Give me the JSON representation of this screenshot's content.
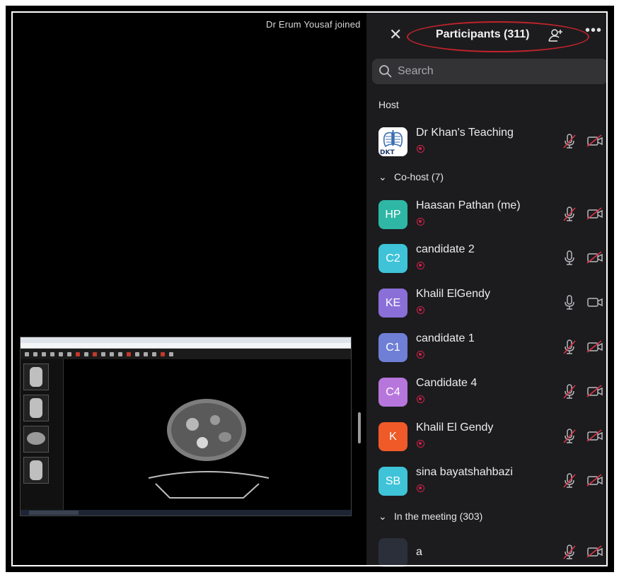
{
  "notification": "Dr Erum Yousaf joined",
  "panel": {
    "title": "Participants (311)",
    "search_placeholder": "Search"
  },
  "sections": {
    "host": "Host",
    "cohost": "Co-host (7)",
    "meeting": "In the meeting (303)"
  },
  "participants": [
    {
      "initials": "",
      "name": "Dr Khan's Teaching",
      "color": "#ffffff",
      "logo_text": "DKT",
      "mic_muted": true,
      "cam_off": true
    },
    {
      "initials": "HP",
      "name": "Haasan Pathan (me)",
      "color": "#2fb7a6",
      "mic_muted": true,
      "cam_off": true
    },
    {
      "initials": "C2",
      "name": "candidate 2",
      "color": "#3ec3d8",
      "mic_muted": false,
      "cam_off": true
    },
    {
      "initials": "KE",
      "name": "Khalil ElGendy",
      "color": "#8a6fd8",
      "mic_muted": false,
      "cam_off": false
    },
    {
      "initials": "C1",
      "name": "candidate 1",
      "color": "#6f7fd6",
      "mic_muted": true,
      "cam_off": true
    },
    {
      "initials": "C4",
      "name": "Candidate 4",
      "color": "#b776dc",
      "mic_muted": true,
      "cam_off": true
    },
    {
      "initials": "K",
      "name": "Khalil El Gendy",
      "color": "#ef5a28",
      "mic_muted": true,
      "cam_off": true
    },
    {
      "initials": "SB",
      "name": "sina bayatshahbazi",
      "color": "#3ec3d8",
      "mic_muted": true,
      "cam_off": true
    },
    {
      "initials": "",
      "name": "a",
      "color": "#2a2f3a",
      "mic_muted": true,
      "cam_off": true
    }
  ],
  "colors": {
    "panel_bg": "#1c1c1e",
    "record_red": "#d0214b",
    "annotation_red": "#c0232b",
    "muted_red": "#e0334a"
  },
  "icons": [
    "close-icon",
    "add-user-icon",
    "more-icon",
    "search-icon",
    "chevron-down-icon",
    "recording-icon",
    "microphone-icon",
    "microphone-muted-icon",
    "video-camera-icon",
    "video-camera-off-icon"
  ]
}
